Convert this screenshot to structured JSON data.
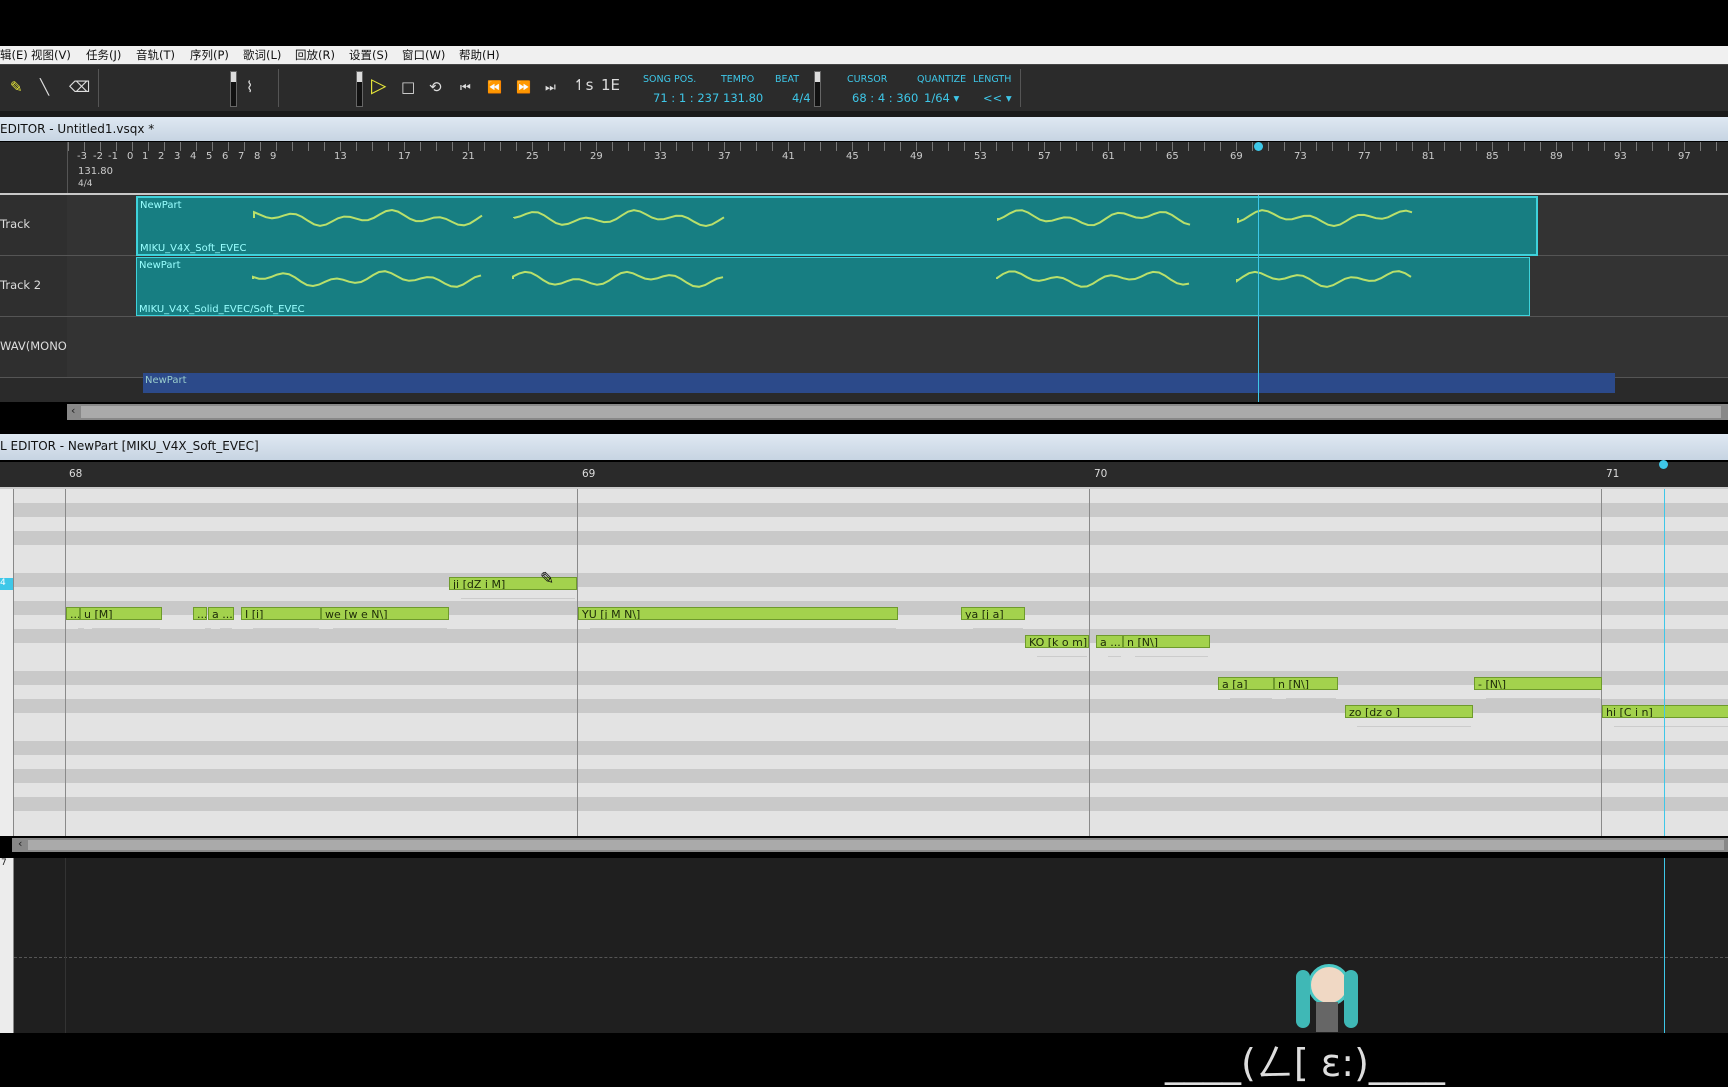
{
  "menu": [
    "辑(E)",
    "视图(V)",
    "任务(J)",
    "音轨(T)",
    "序列(P)",
    "歌词(L)",
    "回放(R)",
    "设置(S)",
    "窗口(W)",
    "帮助(H)"
  ],
  "toolbar": {
    "song_pos_label": "SONG POS.",
    "song_pos": "71 : 1 : 237",
    "tempo_label": "TEMPO",
    "tempo": "131.80",
    "beat_label": "BEAT",
    "beat": "4/4",
    "cursor_label": "CURSOR",
    "cursor": "68 : 4 : 360",
    "quantize_label": "QUANTIZE",
    "quantize": "1/64 ▾",
    "length_label": "LENGTH",
    "length": "<< ▾"
  },
  "musical_editor": {
    "title": "EDITOR - Untitled1.vsqx *",
    "ruler_numbers": [
      "-3",
      "-2",
      "-1",
      "0",
      "1",
      "2",
      "3",
      "4",
      "5",
      "6",
      "7",
      "8",
      "9",
      "13",
      "17",
      "21",
      "25",
      "29",
      "33",
      "37",
      "41",
      "45",
      "49",
      "53",
      "57",
      "61",
      "65",
      "69",
      "73",
      "77",
      "81",
      "85",
      "89",
      "93",
      "97"
    ],
    "ruler_tempo": "131.80",
    "ruler_beat": "4/4",
    "tracks": [
      {
        "name": "Track",
        "part_name": "NewPart",
        "voicebank": "MIKU_V4X_Soft_EVEC"
      },
      {
        "name": "Track 2",
        "part_name": "NewPart",
        "voicebank": "MIKU_V4X_Solid_EVEC/Soft_EVEC"
      },
      {
        "name": "WAV(MONO)",
        "part_name": "NewPart",
        "voicebank": ""
      }
    ],
    "scroll_arrow": "‹"
  },
  "piano_roll": {
    "title": "L EDITOR - NewPart [MIKU_V4X_Soft_EVEC]",
    "bars": [
      "68",
      "69",
      "70",
      "71"
    ],
    "key_marker": "4",
    "notes": [
      {
        "lyric": "...",
        "row": 7
      },
      {
        "lyric": "u [M]",
        "row": 7
      },
      {
        "lyric": "...",
        "row": 7
      },
      {
        "lyric": "a ...",
        "row": 7
      },
      {
        "lyric": "I [i]",
        "row": 7
      },
      {
        "lyric": "we [w e N\\]",
        "row": 7
      },
      {
        "lyric": "ji [dZ i M]",
        "row": 5
      },
      {
        "lyric": "YU [j M N\\]",
        "row": 7
      },
      {
        "lyric": "ya [j a]",
        "row": 7
      },
      {
        "lyric": "KO [k o m]",
        "row": 9
      },
      {
        "lyric": "a ...",
        "row": 9
      },
      {
        "lyric": "n [N\\]",
        "row": 9
      },
      {
        "lyric": "a [a]",
        "row": 12
      },
      {
        "lyric": "n [N\\]",
        "row": 12
      },
      {
        "lyric": "zo [dz o ]",
        "row": 14
      },
      {
        "lyric": "- [N\\]",
        "row": 12
      },
      {
        "lyric": "hi [C i n]",
        "row": 14
      }
    ],
    "scroll_arrow": "‹"
  },
  "control_track": {
    "value": "7"
  },
  "overlay_caption": "____(ㄥ[ ɛ:)____",
  "colors": {
    "accent": "#3ec7e8",
    "note": "#a3d24d",
    "part": "#177e82"
  }
}
